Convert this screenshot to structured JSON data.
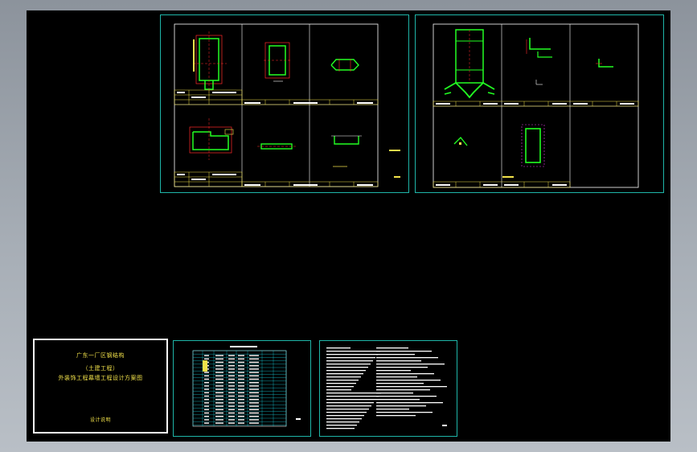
{
  "window": {
    "background_top": "#8c939c",
    "background_bottom": "#b9bfc6",
    "canvas_color": "#000000"
  },
  "colors": {
    "frame": "#1fb5a8",
    "sheet_border": "#ffffff",
    "outline_yellow": "#f2e24a",
    "steel_green": "#22ff22",
    "dim_red": "#ff2a2a",
    "text_white": "#ffffff",
    "magenta": "#e23ce2",
    "cyan": "#17c6d4"
  },
  "cover_sheet": {
    "line1": "广东一厂区钢结构",
    "line2": "（土建工程）",
    "line3": "外装饰工程幕墙工程设计方案图",
    "stamp": "设计说明"
  },
  "drawings": {
    "sheet_a": "section-details-set-1",
    "sheet_b": "section-details-set-2",
    "sheet_index": "drawing-index-table",
    "sheet_notes": "design-notes-text"
  }
}
